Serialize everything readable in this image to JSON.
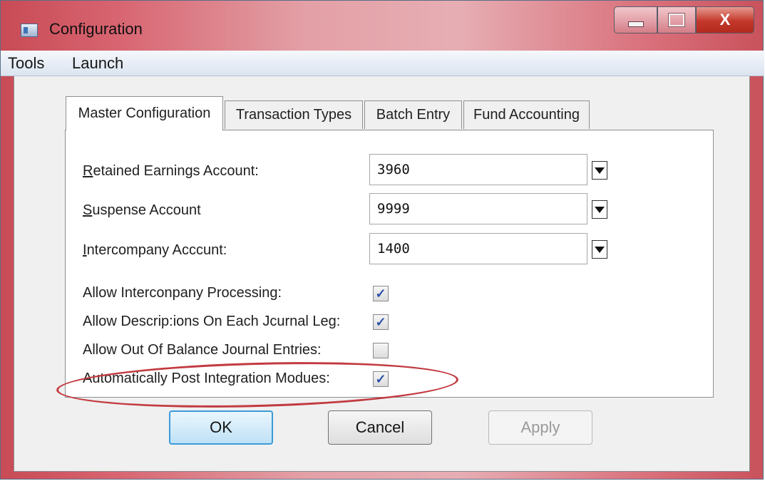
{
  "window": {
    "title": "Configuration",
    "controls": {
      "minimize": "",
      "maximize": "",
      "close": "X"
    }
  },
  "menu": {
    "items": [
      "Tools",
      "Launch"
    ]
  },
  "tabs": [
    {
      "label": "Master Configuration",
      "active": true
    },
    {
      "label": "Transaction Types",
      "active": false
    },
    {
      "label": "Batch Entry",
      "active": false
    },
    {
      "label": "Fund Accounting",
      "active": false
    }
  ],
  "fields": {
    "retained_earnings": {
      "label_first": "R",
      "label_rest": "etained Earnings Account:",
      "value": "3960"
    },
    "suspense": {
      "label_first": "S",
      "label_rest": "uspense Account",
      "value": "9999"
    },
    "intercompany": {
      "label_first": "I",
      "label_rest": "ntercompany Acccunt:",
      "value": "1400"
    }
  },
  "checkboxes": [
    {
      "label": "Allow Interconpany Processing:",
      "checked": true
    },
    {
      "label": "Allow Descrip:ions On Each Jcurnal Leg:",
      "checked": true
    },
    {
      "label": "Allow Out Of Balance Journal Entries:",
      "checked": false
    },
    {
      "label": "Automatically Post Integration Modues:",
      "checked": true
    }
  ],
  "check_glyph": "✓",
  "buttons": {
    "ok": "OK",
    "cancel": "Cancel",
    "apply": "Apply"
  },
  "colors": {
    "highlight": "#c23a40",
    "default_button_border": "#3c9bd8",
    "check": "#2a4fa8"
  }
}
